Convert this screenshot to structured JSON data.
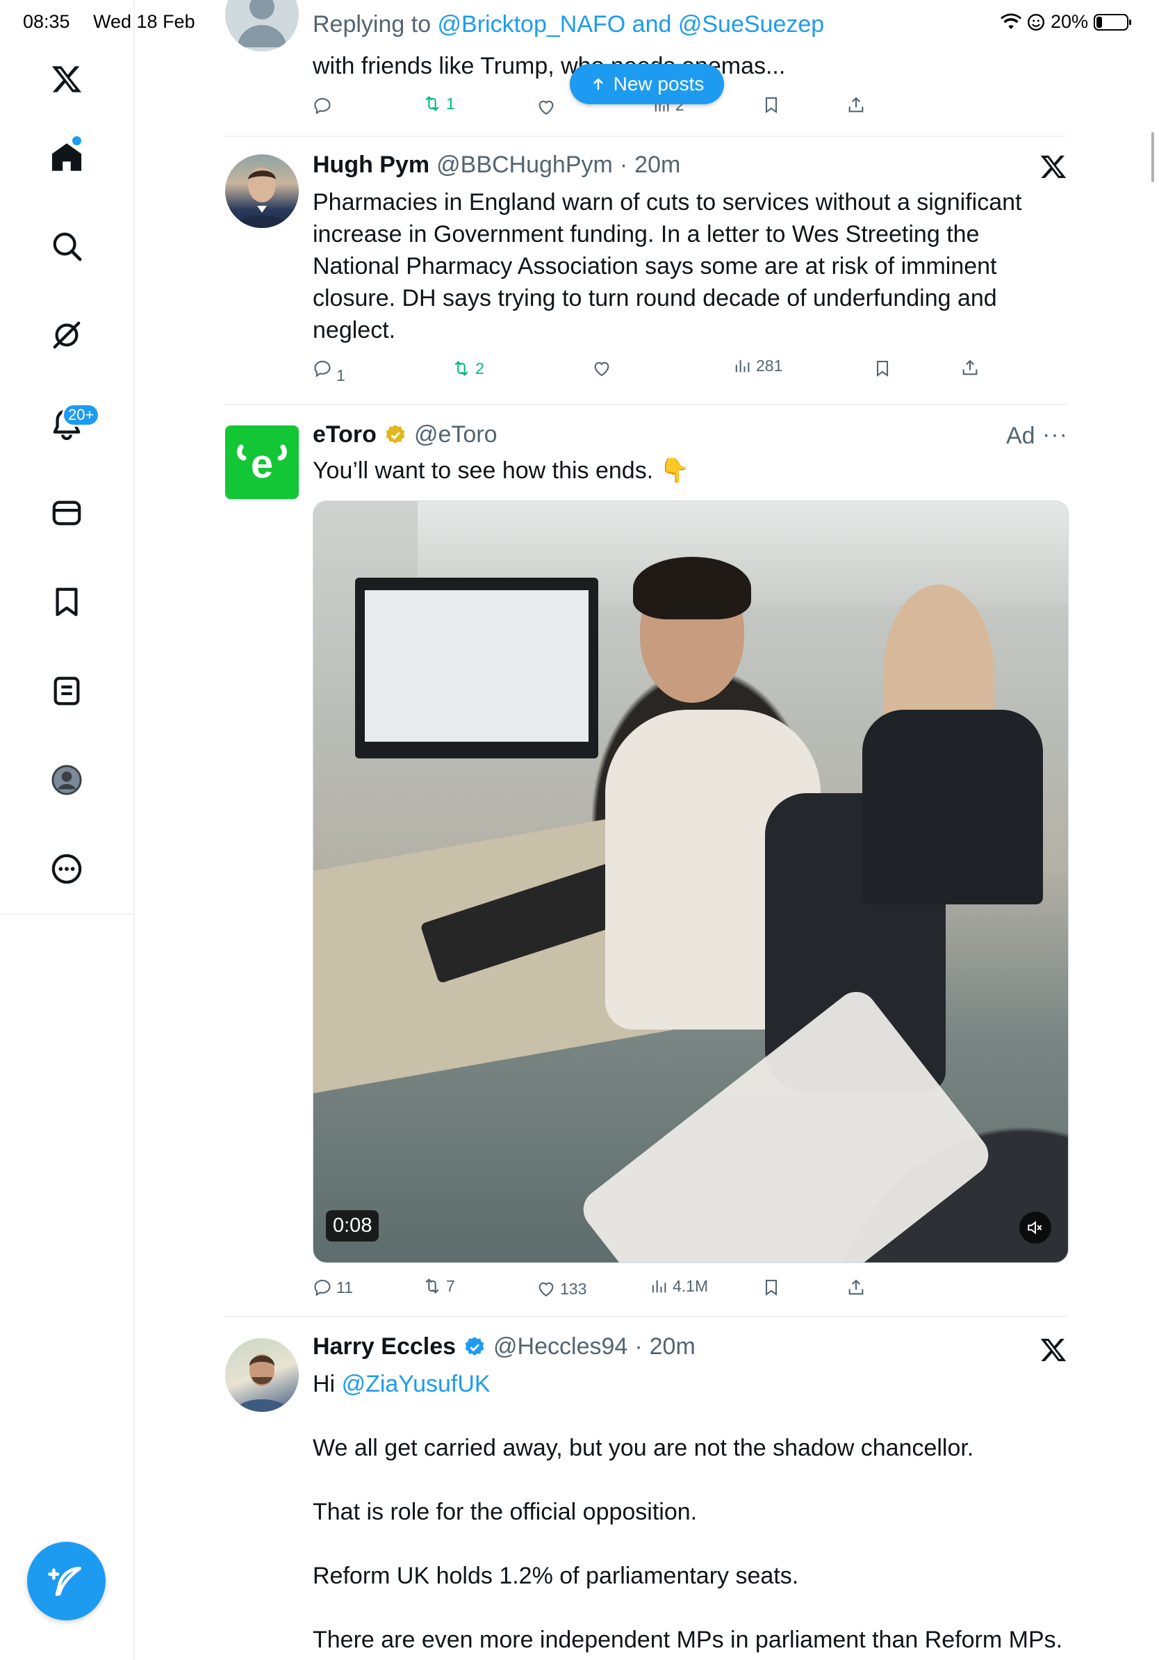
{
  "status_bar": {
    "time": "08:35",
    "date": "Wed 18 Feb",
    "battery": "20%"
  },
  "sidebar": {
    "notifications_badge": "20+"
  },
  "new_posts_label": "New posts",
  "tweets": [
    {
      "reply_to_prefix": "Replying to ",
      "reply_to_handles": "@Bricktop_NAFO and @SueSuezep",
      "text": "with friends like Trump, who needs enemas...",
      "retweets": "1",
      "views": "2"
    },
    {
      "name": "Hugh Pym",
      "handle": "@BBCHughPym",
      "time": "20m",
      "text": "Pharmacies in England warn of cuts to services without a significant increase in Government funding. In a letter to Wes Streeting the National Pharmacy Association says some are at risk of imminent closure. DH says trying to turn round decade of underfunding and neglect.",
      "replies": "1",
      "retweets": "2",
      "views": "281"
    },
    {
      "name": "eToro",
      "handle": "@eToro",
      "ad_label": "Ad",
      "text": "You’ll want to see how this ends. 👇",
      "video_time": "0:08",
      "replies": "11",
      "retweets": "7",
      "likes": "133",
      "views": "4.1M"
    },
    {
      "name": "Harry Eccles",
      "handle": "@Heccles94",
      "time": "20m",
      "text_greeting": "Hi ",
      "mention": "@ZiaYusufUK",
      "paragraphs": [
        "We all get carried away, but you are not the shadow chancellor.",
        "That is role for the official opposition.",
        "Reform UK holds 1.2% of parliamentary seats.",
        "There are even more independent MPs in parliament than Reform MPs."
      ]
    }
  ],
  "colors": {
    "accent": "#1d9bf0",
    "retweet_green": "#00ba7c",
    "etoro_green": "#13c636",
    "verified_gold": "#e2b719"
  }
}
